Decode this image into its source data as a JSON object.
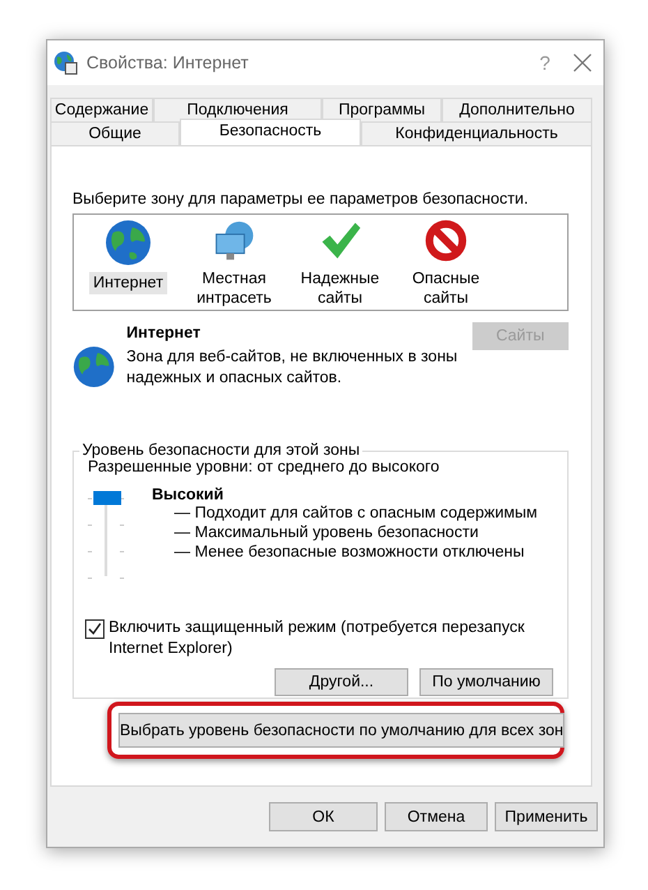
{
  "window": {
    "title": "Свойства: Интернет",
    "help": "?"
  },
  "tab_rows": [
    {
      "tabs": [
        {
          "label": "Содержание",
          "selected": false
        },
        {
          "label": "Подключения",
          "selected": false
        },
        {
          "label": "Программы",
          "selected": false
        },
        {
          "label": "Дополнительно",
          "selected": false
        }
      ]
    },
    {
      "tabs": [
        {
          "label": "Общие",
          "selected": false
        },
        {
          "label": "Безопасность",
          "selected": true
        },
        {
          "label": "Конфиденциальность",
          "selected": false
        }
      ]
    }
  ],
  "zone_prompt": "Выберите зону для параметры ее параметров безопасности.",
  "zones": [
    {
      "kind": "globe",
      "label": "Интернет",
      "selected": true
    },
    {
      "kind": "intranet",
      "label": "Местная интрасеть",
      "selected": false
    },
    {
      "kind": "trusted",
      "label": "Надежные сайты",
      "selected": false
    },
    {
      "kind": "restricted",
      "label": "Опасные сайты",
      "selected": false
    }
  ],
  "zone_info": {
    "title": "Интернет",
    "description": "Зона для веб-сайтов, не включенных в зоны надежных и опасных сайтов.",
    "sites_button": {
      "label": "Сайты",
      "disabled": true
    }
  },
  "security_level": {
    "legend": "Уровень безопасности для этой зоны",
    "allowed": "Разрешенные уровни: от среднего до высокого",
    "level": 1,
    "level_name": "Высокий",
    "bullets": [
      "— Подходит для сайтов с опасным содержимым",
      "— Максимальный уровень безопасности",
      "— Менее безопасные возможности отключены"
    ],
    "protected_mode": {
      "label": "Включить защищенный режим (потребуется перезапуск Internet Explorer)",
      "checked": true
    },
    "buttons": [
      "Другой...",
      "По умолчанию"
    ]
  },
  "reset_all_button": {
    "label": "Выбрать уровень безопасности по умолчанию для всех зон",
    "highlighted": true
  },
  "dialog_buttons": [
    "ОК",
    "Отмена",
    "Применить"
  ]
}
